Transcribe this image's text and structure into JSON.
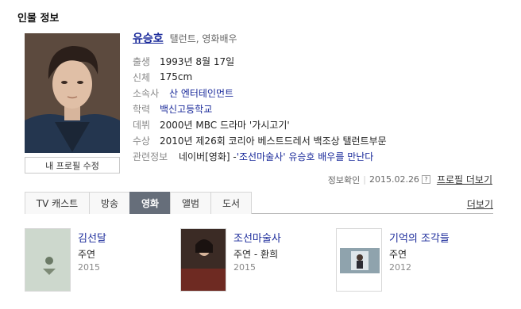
{
  "section_title": "인물 정보",
  "profile": {
    "name": "유승호",
    "role": "탤런트, 영화배우",
    "edit_button": "내 프로필 수정",
    "rows": [
      {
        "label": "출생",
        "value": "1993년 8월 17일"
      },
      {
        "label": "신체",
        "value": "175cm"
      },
      {
        "label": "소속사",
        "value": "산 엔터테인먼트"
      },
      {
        "label": "학력",
        "value": "백신고등학교"
      },
      {
        "label": "데뷔",
        "value": "2000년 MBC 드라마 '가시고기'"
      },
      {
        "label": "수상",
        "value": "2010년 제26회 코리아 베스트드레서 백조상 탤런트부문"
      },
      {
        "label": "관련정보",
        "value_prefix": "네이버[영화] - ",
        "value_link": "'조선마술사' 유승호 배우를 만난다"
      }
    ]
  },
  "verify": {
    "label": "정보확인",
    "date": "2015.02.26",
    "help": "?",
    "more": "프로필 더보기"
  },
  "tabs": {
    "items": [
      "TV 캐스트",
      "방송",
      "영화",
      "앨범",
      "도서"
    ],
    "active_index": 2,
    "more": "더보기"
  },
  "movies": [
    {
      "title": "김선달",
      "role": "주연",
      "year": "2015"
    },
    {
      "title": "조선마술사",
      "role": "주연 - 환희",
      "year": "2015"
    },
    {
      "title": "기억의 조각들",
      "role": "주연",
      "year": "2012"
    }
  ],
  "colors": {
    "link": "#1a2a9a",
    "active_tab": "#666e7a"
  }
}
